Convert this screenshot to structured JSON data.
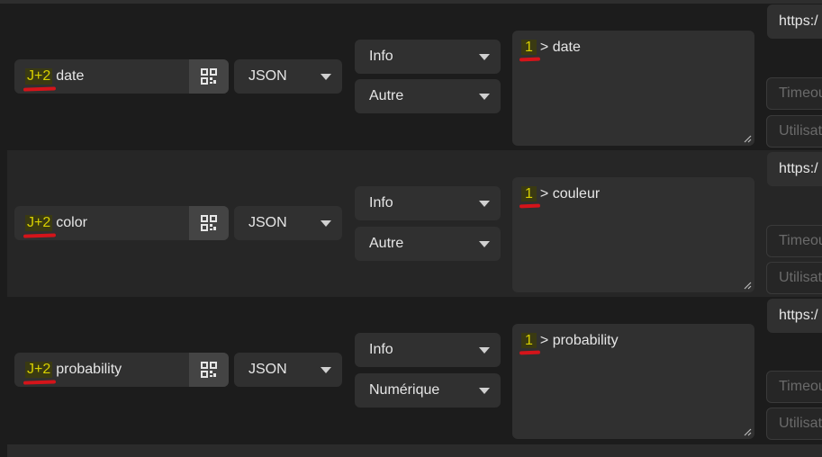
{
  "rows": [
    {
      "badge": "J+2",
      "field_name": "date",
      "format": "JSON",
      "category": "Info",
      "type": "Autre",
      "mapping_number": "1",
      "mapping_path": "> date",
      "url": "https:/",
      "timeout_placeholder": "Timeou",
      "user_placeholder": "Utilisat"
    },
    {
      "badge": "J+2",
      "field_name": "color",
      "format": "JSON",
      "category": "Info",
      "type": "Autre",
      "mapping_number": "1",
      "mapping_path": "> couleur",
      "url": "https:/",
      "timeout_placeholder": "Timeou",
      "user_placeholder": "Utilisat"
    },
    {
      "badge": "J+2",
      "field_name": "probability",
      "format": "JSON",
      "category": "Info",
      "type": "Numérique",
      "mapping_number": "1",
      "mapping_path": "> probability",
      "url": "https:/",
      "timeout_placeholder": "Timeou",
      "user_placeholder": "Utilisat"
    }
  ],
  "icons": {
    "field_action": "qr-code-icon",
    "dropdown": "caret-down-icon",
    "resize": "resize-grip-icon"
  },
  "colors": {
    "badge_text": "#d8d000",
    "annotation_underline": "#d4141a",
    "control_bg": "#303030"
  }
}
